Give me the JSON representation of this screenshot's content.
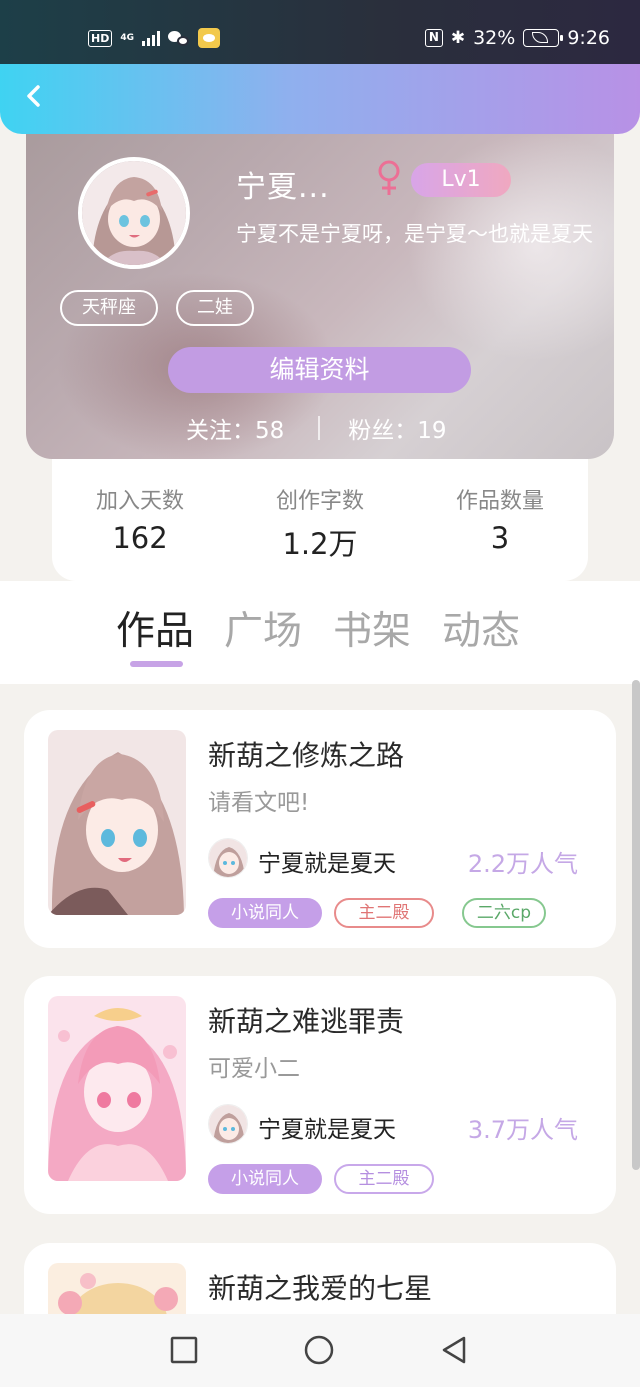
{
  "status_bar": {
    "hd": "HD",
    "network": "4G",
    "battery": "32%",
    "time": "9:26",
    "nfc": "N"
  },
  "profile": {
    "name": "宁夏...",
    "level": "Lv1",
    "bio": "宁夏不是宁夏呀，是宁夏～也就是夏天",
    "tags": [
      "天秤座",
      "二娃"
    ],
    "edit_label": "编辑资料",
    "following_label": "关注：",
    "following_count": "58",
    "followers_label": "粉丝：",
    "followers_count": "19",
    "gender": "female"
  },
  "stats": [
    {
      "label": "加入天数",
      "value": "162"
    },
    {
      "label": "创作字数",
      "value": "1.2万"
    },
    {
      "label": "作品数量",
      "value": "3"
    }
  ],
  "tabs": [
    "作品",
    "广场",
    "书架",
    "动态"
  ],
  "works": [
    {
      "title": "新葫之修炼之路",
      "desc": "请看文吧!",
      "author": "宁夏就是夏天",
      "popularity": "2.2万人气",
      "tags": [
        "小说同人",
        "主二殿",
        "二六cp"
      ]
    },
    {
      "title": "新葫之难逃罪责",
      "desc": "可爱小二",
      "author": "宁夏就是夏天",
      "popularity": "3.7万人气",
      "tags": [
        "小说同人",
        "主二殿"
      ]
    },
    {
      "title": "新葫之我爱的七星"
    }
  ],
  "icons": {
    "back": "chevron-left-icon",
    "gender": "female-icon",
    "nav_recent": "square-icon",
    "nav_home": "circle-icon",
    "nav_back": "triangle-back-icon"
  }
}
